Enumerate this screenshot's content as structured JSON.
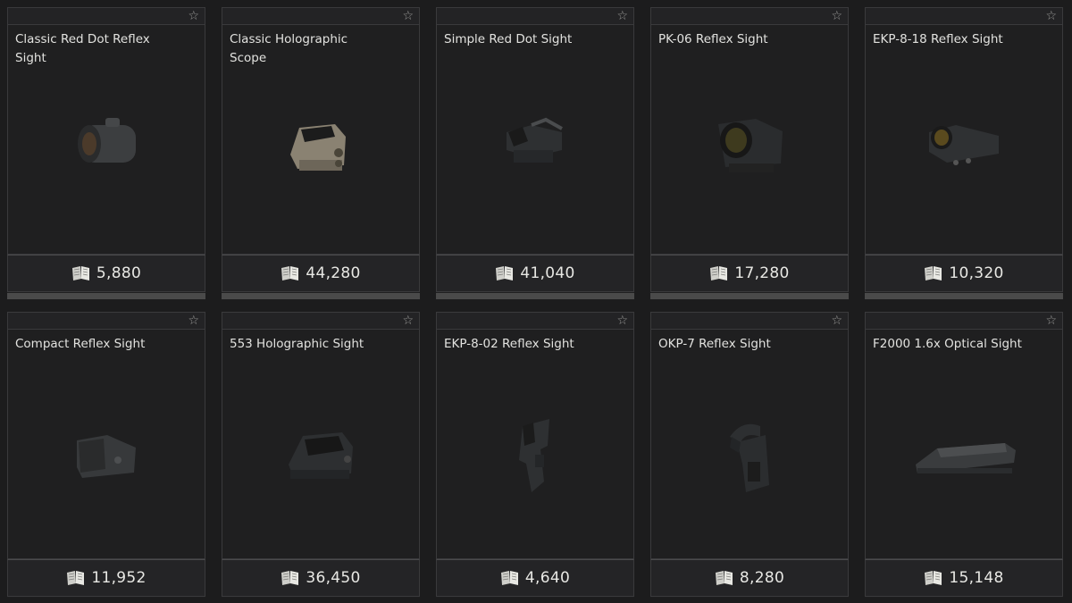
{
  "items": [
    {
      "name": "Classic Red Dot Reflex Sight",
      "price": "5,880",
      "icon": "red-dot-sight-icon"
    },
    {
      "name": "Classic Holographic Scope",
      "price": "44,280",
      "icon": "holographic-scope-icon"
    },
    {
      "name": "Simple Red Dot Sight",
      "price": "41,040",
      "icon": "simple-red-dot-icon"
    },
    {
      "name": "PK-06 Reflex Sight",
      "price": "17,280",
      "icon": "pk06-sight-icon"
    },
    {
      "name": "EKP-8-18 Reflex Sight",
      "price": "10,320",
      "icon": "ekp818-sight-icon"
    },
    {
      "name": "Compact Reflex Sight",
      "price": "11,952",
      "icon": "compact-reflex-icon"
    },
    {
      "name": "553 Holographic Sight",
      "price": "36,450",
      "icon": "holo553-icon"
    },
    {
      "name": "EKP-8-02 Reflex Sight",
      "price": "4,640",
      "icon": "ekp802-sight-icon"
    },
    {
      "name": "OKP-7 Reflex Sight",
      "price": "8,280",
      "icon": "okp7-sight-icon"
    },
    {
      "name": "F2000 1.6x Optical Sight",
      "price": "15,148",
      "icon": "f2000-optic-icon"
    }
  ],
  "currency_icon": "book-currency-icon",
  "favorite_icon": "star-icon"
}
